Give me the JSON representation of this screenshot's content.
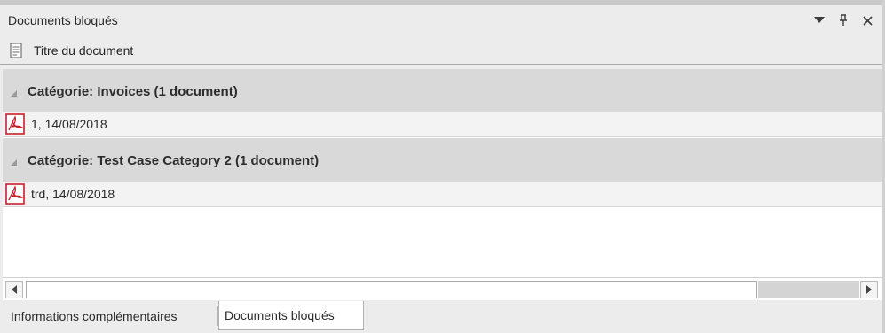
{
  "panel": {
    "title": "Documents bloqués",
    "buttons": {
      "dropdown_icon": "chevron-down-icon",
      "pin_icon": "pin-icon",
      "close_icon": "close-icon"
    }
  },
  "column_header": {
    "icon": "document-icon",
    "label": "Titre du document"
  },
  "groups": [
    {
      "label": "Catégorie: Invoices (1 document)",
      "documents": [
        {
          "icon": "pdf-icon",
          "label": "1, 14/08/2018"
        }
      ]
    },
    {
      "label": "Catégorie: Test Case Category 2 (1 document)",
      "documents": [
        {
          "icon": "pdf-icon",
          "label": "trd, 14/08/2018"
        }
      ]
    }
  ],
  "tabs": [
    {
      "label": "Informations complémentaires",
      "active": false
    },
    {
      "label": "Documents bloqués",
      "active": true
    }
  ],
  "colors": {
    "pdf_red": "#c8202a",
    "group_bg": "#d9d9d9",
    "panel_bg": "#ececec"
  }
}
